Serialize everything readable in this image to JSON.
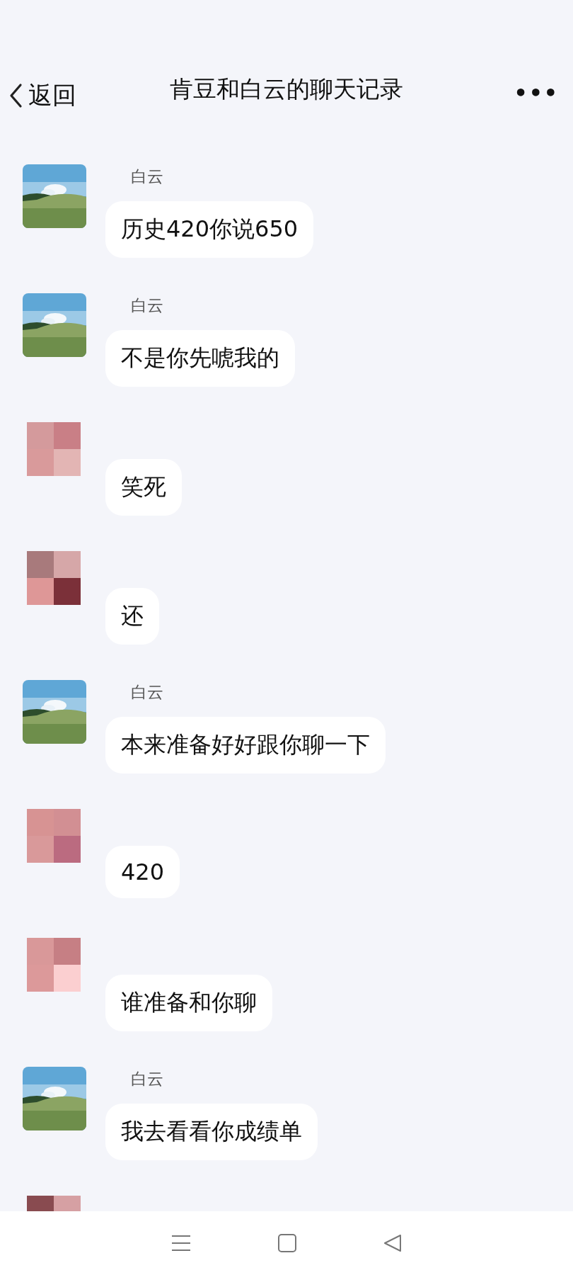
{
  "header": {
    "back": "返回",
    "title": "肯豆和白云的聊天记录",
    "more": "•••"
  },
  "messages": [
    {
      "kind": "landscape",
      "name": "白云",
      "text": "历史420你说650"
    },
    {
      "kind": "landscape",
      "name": "白云",
      "text": "不是你先唬我的"
    },
    {
      "kind": "mosaic",
      "text": "笑死"
    },
    {
      "kind": "mosaic",
      "text": "还"
    },
    {
      "kind": "landscape",
      "name": "白云",
      "text": "本来准备好好跟你聊一下"
    },
    {
      "kind": "mosaic",
      "text": "420"
    },
    {
      "kind": "mosaic",
      "text": "谁准备和你聊"
    },
    {
      "kind": "landscape",
      "name": "白云",
      "text": "我去看看你成绩单"
    },
    {
      "kind": "mosaic"
    }
  ]
}
